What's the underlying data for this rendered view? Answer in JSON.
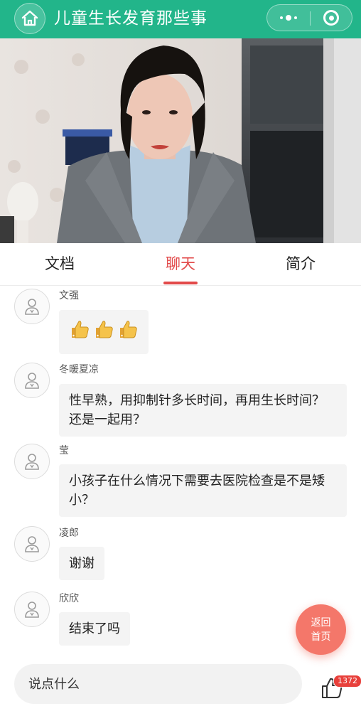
{
  "header": {
    "title": "儿童生长发育那些事",
    "brand_color": "#22b58a"
  },
  "video": {
    "description_icon": "live-video-frame"
  },
  "tabs": [
    {
      "label": "文档",
      "active": false
    },
    {
      "label": "聊天",
      "active": true
    },
    {
      "label": "简介",
      "active": false
    }
  ],
  "accent_color": "#e24a4a",
  "messages": [
    {
      "name": "文强",
      "text": "",
      "emoji": "thumbs-up x3"
    },
    {
      "name": "冬暖夏凉",
      "text": "性早熟，用抑制针多长时间，再用生长时间？还是一起用？"
    },
    {
      "name": "莹",
      "text": "小孩子在什么情况下需要去医院检查是不是矮小？"
    },
    {
      "name": "凌郎",
      "text": "谢谢"
    },
    {
      "name": "欣欣",
      "text": "结束了吗"
    }
  ],
  "float_button": {
    "line1": "返回",
    "line2": "首页"
  },
  "input": {
    "placeholder": "说点什么",
    "value": ""
  },
  "like": {
    "count": "1372"
  }
}
